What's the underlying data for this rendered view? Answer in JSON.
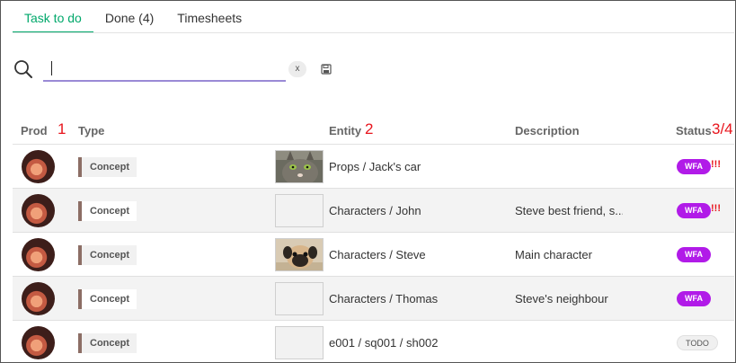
{
  "tabs": [
    {
      "label": "Task to do",
      "active": true
    },
    {
      "label": "Done (4)",
      "active": false
    },
    {
      "label": "Timesheets",
      "active": false
    }
  ],
  "search": {
    "value": "",
    "placeholder": "",
    "clear_label": "x"
  },
  "columns": {
    "prod": "Prod",
    "type": "Type",
    "entity": "Entity",
    "description": "Description",
    "status": "Status"
  },
  "annotations": {
    "prod": "1",
    "entity": "2",
    "status": "3/4"
  },
  "colors": {
    "accent": "#00a86b",
    "wfa": "#b11be8",
    "priority": "#e8141c"
  },
  "rows": [
    {
      "type": "Concept",
      "thumb": "cat",
      "entity": "Props / Jack's car",
      "description": "",
      "status": "WFA",
      "priority": "!!!"
    },
    {
      "type": "Concept",
      "thumb": "empty",
      "entity": "Characters / John",
      "description": "Steve best friend, s...",
      "status": "WFA",
      "priority": "!!!"
    },
    {
      "type": "Concept",
      "thumb": "pug",
      "entity": "Characters / Steve",
      "description": "Main character",
      "status": "WFA",
      "priority": ""
    },
    {
      "type": "Concept",
      "thumb": "empty",
      "entity": "Characters / Thomas",
      "description": "Steve's neighbour",
      "status": "WFA",
      "priority": ""
    },
    {
      "type": "Concept",
      "thumb": "empty",
      "entity": "e001 / sq001 / sh002",
      "description": "",
      "status": "TODO",
      "priority": ""
    }
  ]
}
